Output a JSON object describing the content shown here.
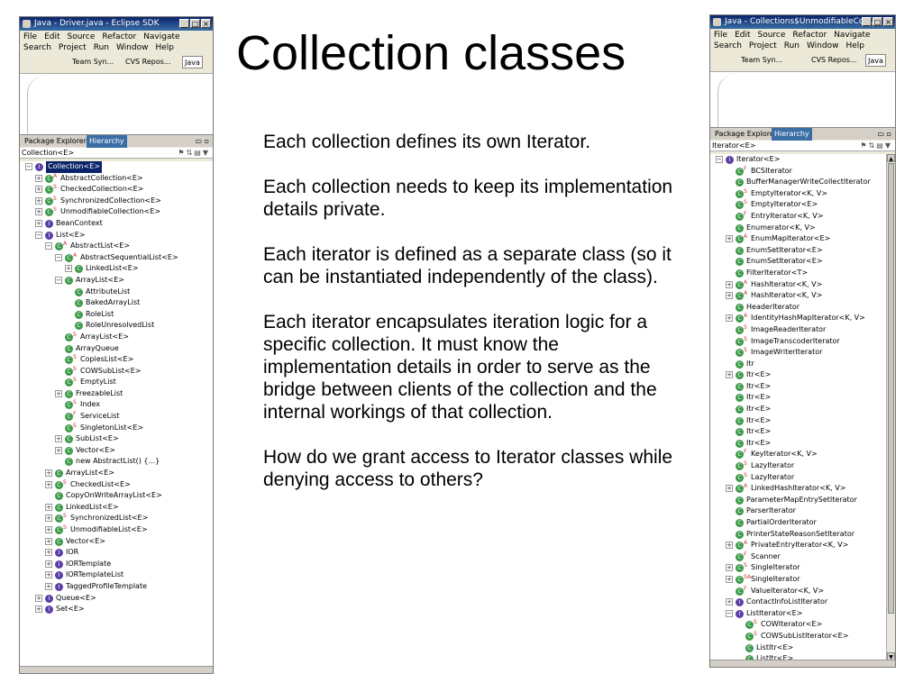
{
  "slide": {
    "title": "Collection classes",
    "paragraphs": [
      "Each collection defines its own Iterator.",
      "Each collection needs to keep its implementation details private.",
      "Each iterator is defined as a separate class (so it can be instantiated independently of the class).",
      "Each iterator encapsulates iteration logic for a specific collection.  It must know the implementation details in order to serve as the bridge between clients of the collection and the internal workings of that collection.",
      "How do we grant access to Iterator classes while denying access to others?"
    ]
  },
  "left_window": {
    "title": "Java - Driver.java - Eclipse SDK",
    "menu_row1": [
      "File",
      "Edit",
      "Source",
      "Refactor",
      "Navigate"
    ],
    "menu_row2": [
      "Search",
      "Project",
      "Run",
      "Window",
      "Help"
    ],
    "perspectives": [
      "Team Syn...",
      "CVS Repos...",
      "Java"
    ],
    "tabs": [
      "Package Explorer",
      "Hierarchy"
    ],
    "path": "Collection<E>",
    "tree": [
      {
        "label": "Collection<E>",
        "kind": "i",
        "depth": 0,
        "exp": "-",
        "sel": true
      },
      {
        "label": "AbstractCollection<E>",
        "kind": "c",
        "mod": "A",
        "depth": 1,
        "exp": "+"
      },
      {
        "label": "CheckedCollection<E>",
        "kind": "c",
        "mod": "S",
        "depth": 1,
        "exp": "+"
      },
      {
        "label": "SynchronizedCollection<E>",
        "kind": "c",
        "mod": "S",
        "depth": 1,
        "exp": "+"
      },
      {
        "label": "UnmodifiableCollection<E>",
        "kind": "c",
        "mod": "S",
        "depth": 1,
        "exp": "+"
      },
      {
        "label": "BeanContext",
        "kind": "i",
        "depth": 1,
        "exp": "+"
      },
      {
        "label": "List<E>",
        "kind": "i",
        "depth": 1,
        "exp": "-"
      },
      {
        "label": "AbstractList<E>",
        "kind": "c",
        "mod": "A",
        "depth": 2,
        "exp": "-"
      },
      {
        "label": "AbstractSequentialList<E>",
        "kind": "c",
        "mod": "A",
        "depth": 3,
        "exp": "-"
      },
      {
        "label": "LinkedList<E>",
        "kind": "c",
        "depth": 4,
        "exp": "+"
      },
      {
        "label": "ArrayList<E>",
        "kind": "c",
        "depth": 3,
        "exp": "-"
      },
      {
        "label": "AttributeList",
        "kind": "c",
        "depth": 4
      },
      {
        "label": "BakedArrayList",
        "kind": "c",
        "depth": 4
      },
      {
        "label": "RoleList",
        "kind": "c",
        "depth": 4
      },
      {
        "label": "RoleUnresolvedList",
        "kind": "c",
        "depth": 4
      },
      {
        "label": "ArrayList<E>",
        "kind": "c",
        "mod": "S",
        "depth": 3
      },
      {
        "label": "ArrayQueue",
        "kind": "c",
        "depth": 3
      },
      {
        "label": "CopiesList<E>",
        "kind": "c",
        "mod": "S",
        "depth": 3
      },
      {
        "label": "COWSubList<E>",
        "kind": "c",
        "mod": "S",
        "depth": 3
      },
      {
        "label": "EmptyList",
        "kind": "c",
        "mod": "S",
        "depth": 3
      },
      {
        "label": "FreezableList",
        "kind": "c",
        "depth": 3,
        "exp": "+"
      },
      {
        "label": "Index",
        "kind": "c",
        "mod": "S",
        "depth": 3
      },
      {
        "label": "ServiceList",
        "kind": "c",
        "mod": "F",
        "depth": 3
      },
      {
        "label": "SingletonList<E>",
        "kind": "c",
        "mod": "S",
        "depth": 3
      },
      {
        "label": "SubList<E>",
        "kind": "c",
        "depth": 3,
        "exp": "+"
      },
      {
        "label": "Vector<E>",
        "kind": "c",
        "depth": 3,
        "exp": "+"
      },
      {
        "label": "new AbstractList() {...}",
        "kind": "c",
        "depth": 3
      },
      {
        "label": "ArrayList<E>",
        "kind": "c",
        "depth": 2,
        "exp": "+"
      },
      {
        "label": "CheckedList<E>",
        "kind": "c",
        "mod": "S",
        "depth": 2,
        "exp": "+"
      },
      {
        "label": "CopyOnWriteArrayList<E>",
        "kind": "c",
        "depth": 2
      },
      {
        "label": "LinkedList<E>",
        "kind": "c",
        "depth": 2,
        "exp": "+"
      },
      {
        "label": "SynchronizedList<E>",
        "kind": "c",
        "mod": "S",
        "depth": 2,
        "exp": "+"
      },
      {
        "label": "UnmodifiableList<E>",
        "kind": "c",
        "mod": "S",
        "depth": 2,
        "exp": "+"
      },
      {
        "label": "Vector<E>",
        "kind": "c",
        "depth": 2,
        "exp": "+"
      },
      {
        "label": "IOR",
        "kind": "i",
        "depth": 2,
        "exp": "+"
      },
      {
        "label": "IORTemplate",
        "kind": "i",
        "depth": 2,
        "exp": "+"
      },
      {
        "label": "IORTemplateList",
        "kind": "i",
        "depth": 2,
        "exp": "+"
      },
      {
        "label": "TaggedProfileTemplate",
        "kind": "i",
        "depth": 2,
        "exp": "+"
      },
      {
        "label": "Queue<E>",
        "kind": "i",
        "depth": 1,
        "exp": "+"
      },
      {
        "label": "Set<E>",
        "kind": "i",
        "depth": 1,
        "exp": "+"
      }
    ]
  },
  "right_window": {
    "title": "Java - Collections$UnmodifiableColl...",
    "menu_row1": [
      "File",
      "Edit",
      "Source",
      "Refactor",
      "Navigate"
    ],
    "menu_row2": [
      "Search",
      "Project",
      "Run",
      "Window",
      "Help"
    ],
    "perspectives": [
      "Team Syn...",
      "CVS Repos...",
      "Java"
    ],
    "tabs": [
      "Package Explorer",
      "Hierarchy"
    ],
    "path": "Iterator<E>",
    "tree": [
      {
        "label": "Iterator<E>",
        "kind": "i",
        "depth": 0,
        "exp": "-"
      },
      {
        "label": "BCSIterator",
        "kind": "c",
        "mod": "F",
        "depth": 1
      },
      {
        "label": "BufferManagerWriteCollectIterator",
        "kind": "c",
        "depth": 1
      },
      {
        "label": "EmptyIterator<K, V>",
        "kind": "c",
        "mod": "S",
        "depth": 1
      },
      {
        "label": "EmptyIterator<E>",
        "kind": "c",
        "mod": "S",
        "depth": 1
      },
      {
        "label": "EntryIterator<K, V>",
        "kind": "c",
        "mod": "F",
        "depth": 1
      },
      {
        "label": "Enumerator<K, V>",
        "kind": "c",
        "depth": 1
      },
      {
        "label": "EnumMapIterator<E>",
        "kind": "c",
        "mod": "A",
        "depth": 1,
        "exp": "+"
      },
      {
        "label": "EnumSetIterator<E>",
        "kind": "c",
        "depth": 1
      },
      {
        "label": "EnumSetIterator<E>",
        "kind": "c",
        "depth": 1
      },
      {
        "label": "FilterIterator<T>",
        "kind": "c",
        "depth": 1
      },
      {
        "label": "HashIterator<K, V>",
        "kind": "c",
        "mod": "A",
        "depth": 1,
        "exp": "+"
      },
      {
        "label": "HashIterator<K, V>",
        "kind": "c",
        "mod": "A",
        "depth": 1,
        "exp": "+"
      },
      {
        "label": "HeaderIterator",
        "kind": "c",
        "depth": 1
      },
      {
        "label": "IdentityHashMapIterator<K, V>",
        "kind": "c",
        "mod": "A",
        "depth": 1,
        "exp": "+"
      },
      {
        "label": "ImageReaderIterator",
        "kind": "c",
        "mod": "S",
        "depth": 1
      },
      {
        "label": "ImageTranscoderIterator",
        "kind": "c",
        "mod": "S",
        "depth": 1
      },
      {
        "label": "ImageWriterIterator",
        "kind": "c",
        "mod": "S",
        "depth": 1
      },
      {
        "label": "Itr",
        "kind": "c",
        "depth": 1
      },
      {
        "label": "Itr<E>",
        "kind": "c",
        "depth": 1,
        "exp": "+"
      },
      {
        "label": "Itr<E>",
        "kind": "c",
        "depth": 1
      },
      {
        "label": "Itr<E>",
        "kind": "c",
        "depth": 1
      },
      {
        "label": "Itr<E>",
        "kind": "c",
        "depth": 1
      },
      {
        "label": "Itr<E>",
        "kind": "c",
        "depth": 1
      },
      {
        "label": "Itr<E>",
        "kind": "c",
        "depth": 1
      },
      {
        "label": "Itr<E>",
        "kind": "c",
        "depth": 1
      },
      {
        "label": "KeyIterator<K, V>",
        "kind": "c",
        "mod": "F",
        "depth": 1
      },
      {
        "label": "LazyIterator",
        "kind": "c",
        "mod": "S",
        "depth": 1
      },
      {
        "label": "LazyIterator",
        "kind": "c",
        "mod": "S",
        "depth": 1
      },
      {
        "label": "LinkedHashIterator<K, V>",
        "kind": "c",
        "mod": "A",
        "depth": 1,
        "exp": "+"
      },
      {
        "label": "ParameterMapEntrySetIterator",
        "kind": "c",
        "depth": 1
      },
      {
        "label": "ParserIterator",
        "kind": "c",
        "depth": 1
      },
      {
        "label": "PartialOrderIterator",
        "kind": "c",
        "depth": 1
      },
      {
        "label": "PrinterStateReasonSetIterator",
        "kind": "c",
        "depth": 1
      },
      {
        "label": "PrivateEntryIterator<K, V>",
        "kind": "c",
        "mod": "A",
        "depth": 1,
        "exp": "+"
      },
      {
        "label": "Scanner",
        "kind": "c",
        "mod": "F",
        "depth": 1
      },
      {
        "label": "SingleIterator",
        "kind": "c",
        "mod": "S",
        "depth": 1,
        "exp": "+"
      },
      {
        "label": "SingleIterator",
        "kind": "c",
        "mod": "SA",
        "depth": 1,
        "exp": "+"
      },
      {
        "label": "ValueIterator<K, V>",
        "kind": "c",
        "mod": "F",
        "depth": 1
      },
      {
        "label": "ContactInfoListIterator",
        "kind": "i",
        "depth": 1,
        "exp": "+"
      },
      {
        "label": "ListIterator<E>",
        "kind": "i",
        "depth": 1,
        "exp": "-"
      },
      {
        "label": "COWIterator<E>",
        "kind": "c",
        "mod": "S",
        "depth": 2
      },
      {
        "label": "COWSubListIterator<E>",
        "kind": "c",
        "mod": "S",
        "depth": 2
      },
      {
        "label": "ListItr<E>",
        "kind": "c",
        "depth": 2
      },
      {
        "label": "ListItr<E>",
        "kind": "c",
        "depth": 2
      }
    ]
  }
}
